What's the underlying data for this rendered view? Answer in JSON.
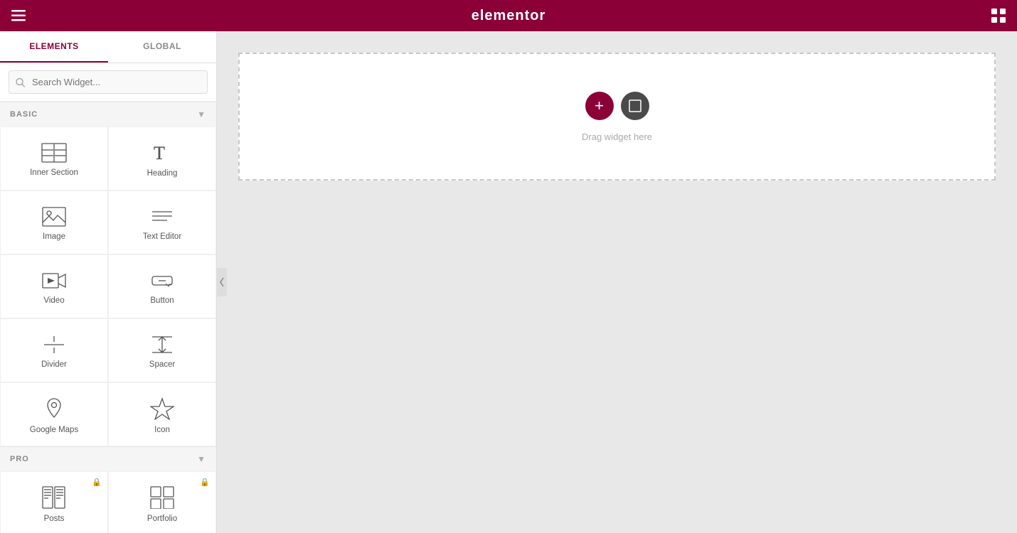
{
  "header": {
    "logo": "elementor",
    "menu_icon": "≡",
    "grid_icon": "⊞"
  },
  "sidebar": {
    "tabs": [
      {
        "label": "ELEMENTS",
        "active": true
      },
      {
        "label": "GLOBAL",
        "active": false
      }
    ],
    "search": {
      "placeholder": "Search Widget..."
    },
    "sections": [
      {
        "label": "BASIC",
        "expanded": true,
        "widgets": [
          {
            "id": "inner-section",
            "label": "Inner Section",
            "icon": "inner-section-icon",
            "pro": false
          },
          {
            "id": "heading",
            "label": "Heading",
            "icon": "heading-icon",
            "pro": false
          },
          {
            "id": "image",
            "label": "Image",
            "icon": "image-icon",
            "pro": false
          },
          {
            "id": "text-editor",
            "label": "Text Editor",
            "icon": "text-editor-icon",
            "pro": false
          },
          {
            "id": "video",
            "label": "Video",
            "icon": "video-icon",
            "pro": false
          },
          {
            "id": "button",
            "label": "Button",
            "icon": "button-icon",
            "pro": false
          },
          {
            "id": "divider",
            "label": "Divider",
            "icon": "divider-icon",
            "pro": false
          },
          {
            "id": "spacer",
            "label": "Spacer",
            "icon": "spacer-icon",
            "pro": false
          },
          {
            "id": "google-maps",
            "label": "Google Maps",
            "icon": "google-maps-icon",
            "pro": false
          },
          {
            "id": "icon",
            "label": "Icon",
            "icon": "icon-icon",
            "pro": false
          }
        ]
      },
      {
        "label": "PRO",
        "expanded": true,
        "widgets": [
          {
            "id": "posts",
            "label": "Posts",
            "icon": "posts-icon",
            "pro": true
          },
          {
            "id": "portfolio",
            "label": "Portfolio",
            "icon": "portfolio-icon",
            "pro": true
          }
        ]
      }
    ]
  },
  "canvas": {
    "drop_label": "Drag widget here",
    "btn_add_label": "+",
    "btn_layout_label": "□"
  },
  "colors": {
    "brand": "#8b0037",
    "dark_btn": "#4a4a4a"
  }
}
